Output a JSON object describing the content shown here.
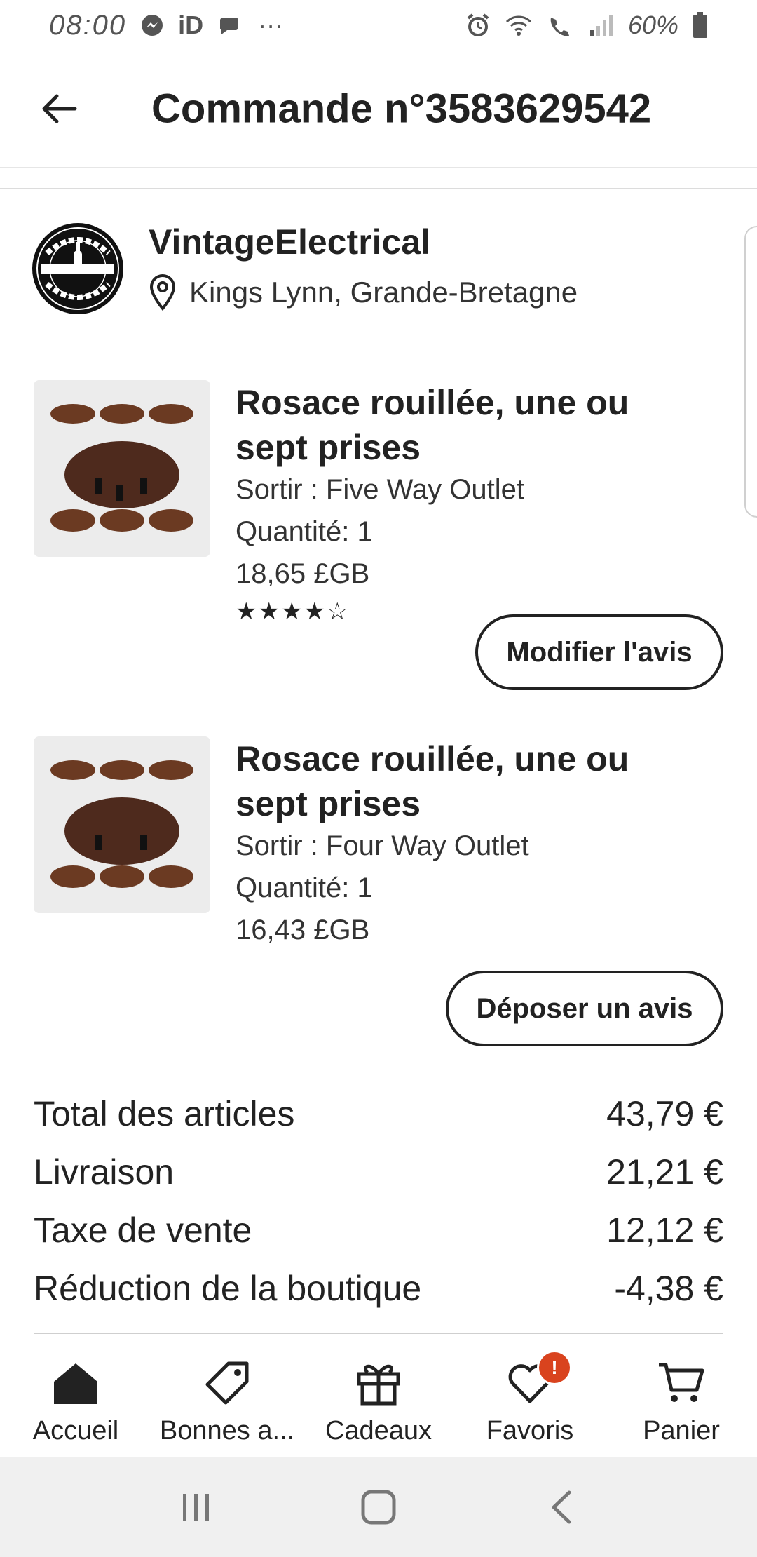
{
  "status_bar": {
    "time": "08:00",
    "left_icons": [
      "messenger-icon",
      "id-icon",
      "chat-bubble-icon",
      "more-dots-icon"
    ],
    "id_text": "iD",
    "dots": "···",
    "right_icons": [
      "alarm-icon",
      "wifi-icon",
      "wifi-call-icon",
      "signal-icon",
      "battery-icon"
    ],
    "battery": "60%"
  },
  "header": {
    "title": "Commande n°3583629542"
  },
  "shop": {
    "name": "VintageElectrical",
    "location": "Kings Lynn, Grande-Bretagne",
    "logo_text": "VINTAGE ELECTRICAL"
  },
  "items": [
    {
      "title": "Rosace rouillée, une ou sept prises",
      "variant": "Sortir : Five Way Outlet",
      "quantity": "Quantité: 1",
      "price": "18,65 £GB",
      "rating": 4,
      "rating_max": 5,
      "button": "Modifier l'avis"
    },
    {
      "title": "Rosace rouillée, une ou sept prises",
      "variant": "Sortir : Four Way Outlet",
      "quantity": "Quantité: 1",
      "price": "16,43 £GB",
      "button": "Déposer un avis"
    }
  ],
  "totals": [
    {
      "label": "Total des articles",
      "value": "43,79 €"
    },
    {
      "label": "Livraison",
      "value": "21,21 €"
    },
    {
      "label": "Taxe de vente",
      "value": "12,12 €"
    },
    {
      "label": "Réduction de la boutique",
      "value": "-4,38 €"
    }
  ],
  "bottom_nav": [
    {
      "label": "Accueil",
      "icon": "home-icon"
    },
    {
      "label": "Bonnes a...",
      "icon": "tag-icon"
    },
    {
      "label": "Cadeaux",
      "icon": "gift-icon"
    },
    {
      "label": "Favoris",
      "icon": "heart-icon",
      "badge": "!"
    },
    {
      "label": "Panier",
      "icon": "cart-icon"
    }
  ],
  "colors": {
    "text": "#222222",
    "badge": "#d9431e",
    "system_nav_bg": "#f0f0f0"
  }
}
